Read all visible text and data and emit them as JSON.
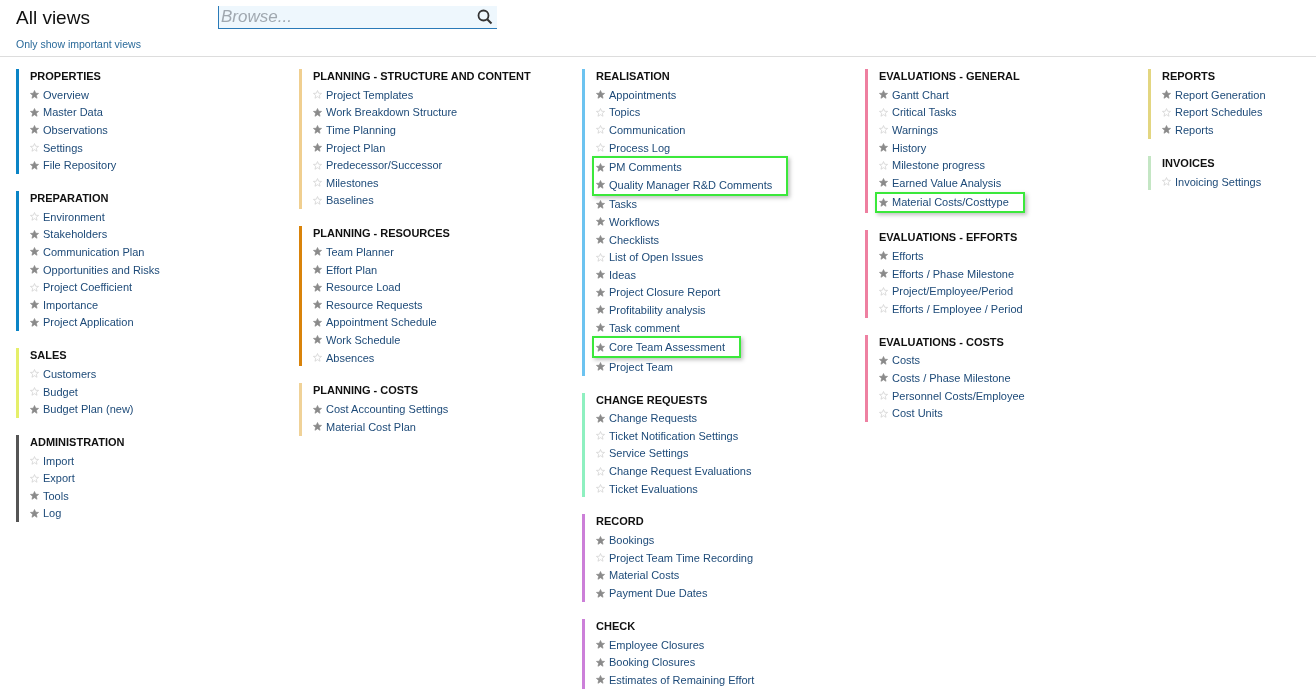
{
  "header": {
    "title": "All views",
    "filter_link": "Only show important views",
    "search": {
      "placeholder": "Browse..."
    }
  },
  "columns": [
    {
      "groups": [
        {
          "title": "PROPERTIES",
          "color": "#0a84c6",
          "items": [
            {
              "label": "Overview",
              "starred": true,
              "highlighted": false
            },
            {
              "label": "Master Data",
              "starred": true,
              "highlighted": false
            },
            {
              "label": "Observations",
              "starred": true,
              "highlighted": false
            },
            {
              "label": "Settings",
              "starred": false,
              "highlighted": false
            },
            {
              "label": "File Repository",
              "starred": true,
              "highlighted": false
            }
          ]
        },
        {
          "title": "PREPARATION",
          "color": "#0a84c6",
          "items": [
            {
              "label": "Environment",
              "starred": false,
              "highlighted": false
            },
            {
              "label": "Stakeholders",
              "starred": true,
              "highlighted": false
            },
            {
              "label": "Communication Plan",
              "starred": true,
              "highlighted": false
            },
            {
              "label": "Opportunities and Risks",
              "starred": true,
              "highlighted": false
            },
            {
              "label": "Project Coefficient",
              "starred": false,
              "highlighted": false
            },
            {
              "label": "Importance",
              "starred": true,
              "highlighted": false
            },
            {
              "label": "Project Application",
              "starred": true,
              "highlighted": false
            }
          ]
        },
        {
          "title": "SALES",
          "color": "#e5ef6a",
          "items": [
            {
              "label": "Customers",
              "starred": false,
              "highlighted": false
            },
            {
              "label": "Budget",
              "starred": false,
              "highlighted": false
            },
            {
              "label": "Budget Plan (new)",
              "starred": true,
              "highlighted": false
            }
          ]
        },
        {
          "title": "ADMINISTRATION",
          "color": "#555555",
          "items": [
            {
              "label": "Import",
              "starred": false,
              "highlighted": false
            },
            {
              "label": "Export",
              "starred": false,
              "highlighted": false
            },
            {
              "label": "Tools",
              "starred": true,
              "highlighted": false
            },
            {
              "label": "Log",
              "starred": true,
              "highlighted": false
            }
          ]
        }
      ]
    },
    {
      "groups": [
        {
          "title": "PLANNING - STRUCTURE AND CONTENT",
          "color": "#f0cf90",
          "items": [
            {
              "label": "Project Templates",
              "starred": false,
              "highlighted": false
            },
            {
              "label": "Work Breakdown Structure",
              "starred": true,
              "highlighted": false
            },
            {
              "label": "Time Planning",
              "starred": true,
              "highlighted": false
            },
            {
              "label": "Project Plan",
              "starred": true,
              "highlighted": false
            },
            {
              "label": "Predecessor/Successor",
              "starred": false,
              "highlighted": false
            },
            {
              "label": "Milestones",
              "starred": false,
              "highlighted": false
            },
            {
              "label": "Baselines",
              "starred": false,
              "highlighted": false
            }
          ]
        },
        {
          "title": "PLANNING - RESOURCES",
          "color": "#d9830a",
          "items": [
            {
              "label": "Team Planner",
              "starred": true,
              "highlighted": false
            },
            {
              "label": "Effort Plan",
              "starred": true,
              "highlighted": false
            },
            {
              "label": "Resource Load",
              "starred": true,
              "highlighted": false
            },
            {
              "label": "Resource Requests",
              "starred": true,
              "highlighted": false
            },
            {
              "label": "Appointment Schedule",
              "starred": true,
              "highlighted": false
            },
            {
              "label": "Work Schedule",
              "starred": true,
              "highlighted": false
            },
            {
              "label": "Absences",
              "starred": false,
              "highlighted": false
            }
          ]
        },
        {
          "title": "PLANNING - COSTS",
          "color": "#f0d298",
          "items": [
            {
              "label": "Cost Accounting Settings",
              "starred": true,
              "highlighted": false
            },
            {
              "label": "Material Cost Plan",
              "starred": true,
              "highlighted": false
            }
          ]
        }
      ]
    },
    {
      "groups": [
        {
          "title": "REALISATION",
          "color": "#6cc3f0",
          "items": [
            {
              "label": "Appointments",
              "starred": true,
              "highlighted": false
            },
            {
              "label": "Topics",
              "starred": false,
              "highlighted": false
            },
            {
              "label": "Communication",
              "starred": false,
              "highlighted": false
            },
            {
              "label": "Process Log",
              "starred": false,
              "highlighted": false
            },
            {
              "label": "PM Comments",
              "starred": true,
              "highlighted": true
            },
            {
              "label": "Quality Manager R&D Comments",
              "starred": true,
              "highlighted": true
            },
            {
              "label": "Tasks",
              "starred": true,
              "highlighted": false
            },
            {
              "label": "Workflows",
              "starred": true,
              "highlighted": false
            },
            {
              "label": "Checklists",
              "starred": true,
              "highlighted": false
            },
            {
              "label": "List of Open Issues",
              "starred": false,
              "highlighted": false
            },
            {
              "label": "Ideas",
              "starred": true,
              "highlighted": false
            },
            {
              "label": "Project Closure Report",
              "starred": true,
              "highlighted": false
            },
            {
              "label": "Profitability analysis",
              "starred": true,
              "highlighted": false
            },
            {
              "label": "Task comment",
              "starred": true,
              "highlighted": false
            },
            {
              "label": "Core Team Assessment",
              "starred": true,
              "highlighted": true
            },
            {
              "label": "Project Team",
              "starred": true,
              "highlighted": false
            }
          ]
        },
        {
          "title": "CHANGE REQUESTS",
          "color": "#8ef0c0",
          "items": [
            {
              "label": "Change Requests",
              "starred": true,
              "highlighted": false
            },
            {
              "label": "Ticket Notification Settings",
              "starred": false,
              "highlighted": false
            },
            {
              "label": "Service Settings",
              "starred": false,
              "highlighted": false
            },
            {
              "label": "Change Request Evaluations",
              "starred": false,
              "highlighted": false
            },
            {
              "label": "Ticket Evaluations",
              "starred": false,
              "highlighted": false
            }
          ]
        },
        {
          "title": "RECORD",
          "color": "#cc7fd8",
          "items": [
            {
              "label": "Bookings",
              "starred": true,
              "highlighted": false
            },
            {
              "label": "Project Team Time Recording",
              "starred": false,
              "highlighted": false
            },
            {
              "label": "Material Costs",
              "starred": true,
              "highlighted": false
            },
            {
              "label": "Payment Due Dates",
              "starred": true,
              "highlighted": false
            }
          ]
        },
        {
          "title": "CHECK",
          "color": "#cc80d9",
          "items": [
            {
              "label": "Employee Closures",
              "starred": true,
              "highlighted": false
            },
            {
              "label": "Booking Closures",
              "starred": true,
              "highlighted": false
            },
            {
              "label": "Estimates of Remaining Effort",
              "starred": true,
              "highlighted": false
            }
          ]
        }
      ]
    },
    {
      "groups": [
        {
          "title": "EVALUATIONS - GENERAL",
          "color": "#ee7fa0",
          "items": [
            {
              "label": "Gantt Chart",
              "starred": true,
              "highlighted": false
            },
            {
              "label": "Critical Tasks",
              "starred": false,
              "highlighted": false
            },
            {
              "label": "Warnings",
              "starred": false,
              "highlighted": false
            },
            {
              "label": "History",
              "starred": true,
              "highlighted": false
            },
            {
              "label": "Milestone progress",
              "starred": false,
              "highlighted": false
            },
            {
              "label": "Earned Value Analysis",
              "starred": true,
              "highlighted": false
            },
            {
              "label": "Material Costs/Costtype",
              "starred": true,
              "highlighted": true
            }
          ]
        },
        {
          "title": "EVALUATIONS - EFFORTS",
          "color": "#ee80a1",
          "items": [
            {
              "label": "Efforts",
              "starred": true,
              "highlighted": false
            },
            {
              "label": "Efforts / Phase Milestone",
              "starred": true,
              "highlighted": false
            },
            {
              "label": "Project/Employee/Period",
              "starred": false,
              "highlighted": false
            },
            {
              "label": "Efforts / Employee / Period",
              "starred": false,
              "highlighted": false
            }
          ]
        },
        {
          "title": "EVALUATIONS - COSTS",
          "color": "#ee81a2",
          "items": [
            {
              "label": "Costs",
              "starred": true,
              "highlighted": false
            },
            {
              "label": "Costs / Phase Milestone",
              "starred": true,
              "highlighted": false
            },
            {
              "label": "Personnel Costs/Employee",
              "starred": false,
              "highlighted": false
            },
            {
              "label": "Cost Units",
              "starred": false,
              "highlighted": false
            }
          ]
        }
      ]
    },
    {
      "groups": [
        {
          "title": "REPORTS",
          "color": "#e3d681",
          "items": [
            {
              "label": "Report Generation",
              "starred": true,
              "highlighted": false
            },
            {
              "label": "Report Schedules",
              "starred": false,
              "highlighted": false
            },
            {
              "label": "Reports",
              "starred": true,
              "highlighted": false
            }
          ]
        },
        {
          "title": "INVOICES",
          "color": "#c4e6c4",
          "items": [
            {
              "label": "Invoicing Settings",
              "starred": false,
              "highlighted": false
            }
          ]
        }
      ]
    }
  ]
}
